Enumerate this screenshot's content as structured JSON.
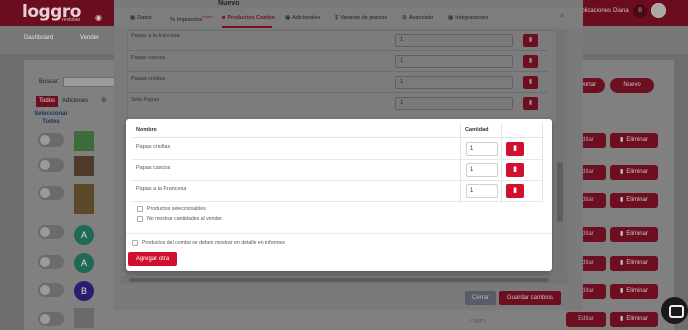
{
  "app": {
    "logo_text": "loggro",
    "logo_sub": "restobar",
    "top_right_text_1": "aplicaciones",
    "top_right_text_2": "Diana",
    "notification_count": "0"
  },
  "subnav": {
    "dashboard": "Dashboard",
    "vender": "Vender"
  },
  "background": {
    "search_label": "Buscar:",
    "tabs": [
      "Todos",
      "Adiciones",
      "B"
    ],
    "select_all": "Seleccionar Todos",
    "avatars": [
      "A",
      "A",
      "B"
    ],
    "import_label": "Importar",
    "new_label": "Nuevo",
    "edit_label": "Editar",
    "delete_label": "Eliminar",
    "footer_text": "Loggro"
  },
  "modal_product": {
    "title": "Nuevo",
    "tabs": [
      {
        "label": "Datos",
        "badge": ""
      },
      {
        "label": "Impuestos",
        "badge": "Nuevo"
      },
      {
        "label": "Productos Combo",
        "badge": ""
      },
      {
        "label": "Adicionales",
        "badge": ""
      },
      {
        "label": "Variante de precios",
        "badge": ""
      },
      {
        "label": "Avanzado",
        "badge": ""
      },
      {
        "label": "Integraciones",
        "badge": ""
      }
    ],
    "close_icon": "×",
    "rows": [
      {
        "label": "Papas a la francesa",
        "qty": "1"
      },
      {
        "label": "Papas cascos",
        "qty": "1"
      },
      {
        "label": "Papas criollas",
        "qty": "1"
      },
      {
        "label": "Solo Papas",
        "qty": "1"
      }
    ],
    "cancel_label": "Cerrar",
    "save_label": "Guardar cambios"
  },
  "modal_combo": {
    "col_name": "Nombre",
    "col_qty": "Cantidad",
    "items": [
      {
        "name": "Papas criollas",
        "qty": "1"
      },
      {
        "name": "Papas cascos",
        "qty": "1"
      },
      {
        "name": "Papas a la Francesa",
        "qty": "1"
      }
    ],
    "check_selected": "Productos seleccionables",
    "check_hide_qty": "No mostrar cantidades al vender",
    "check_detail": "Productos del combo se deben mostrar en detalle en informes",
    "add_label": "Agregar otra"
  },
  "colors": {
    "brand": "#d0102d",
    "brand_dark": "#6e0f21"
  }
}
